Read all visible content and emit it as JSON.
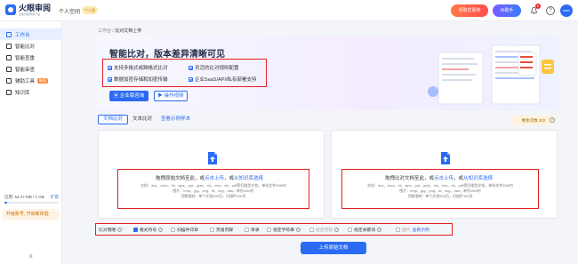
{
  "header": {
    "logo_title": "火眼审阅",
    "logo_sub": "全能智能审阅产品",
    "space_name": "个人空间",
    "plan_badge": "个人版",
    "promo_button": "领取优惠券",
    "ai_button": "AI助手",
    "notification_count": "6",
    "avatar_text": "user"
  },
  "sidebar": {
    "items": [
      {
        "label": "工作台"
      },
      {
        "label": "智能比对"
      },
      {
        "label": "智能查重"
      },
      {
        "label": "智能审查"
      },
      {
        "label": "辅助工具",
        "tag": "新版"
      },
      {
        "label": "知识库"
      }
    ],
    "storage_text": "已用: 54.47 MB / 1 GB",
    "expand_label": "扩容",
    "storage_used_fraction": 0.05,
    "upgrade_label": "升级账号, 开启新体验",
    "collapse_label": "≡"
  },
  "breadcrumb": {
    "parent": "工作台",
    "separator": " / ",
    "current": "比对文档上传"
  },
  "banner": {
    "title": "智能比对，版本差异清晰可见",
    "features": [
      "支持多格式或跨格式比对",
      "灵活的比对规则配置",
      "数据加密存储和加密传输",
      "企业SaaS/API/私有部署支持"
    ],
    "primary_button": "企业版咨询",
    "video_button": "操作视频"
  },
  "tabs": [
    {
      "label": "文档比对",
      "active": true
    },
    {
      "label": "文本比对",
      "active": false
    },
    {
      "label": "查看示例样本",
      "active": false,
      "link": true
    }
  ],
  "quota": {
    "text": "剩余次数 202"
  },
  "upload_left": {
    "title_prefix": "拖拽原始文档至此，或",
    "upload_link": "点击上传",
    "or": "，或",
    "kb_link": "从知识库选择",
    "desc_line1": "文档：doc、docx、rtf、wps、ppt、pptx、xls、xlsx、txt、pdf等扫描型文档，单份文件50M内",
    "desc_line2": "图片：bmp、jpg、png、tif、svg、raw，单份10M内",
    "desc_line3": "页数限制：单个文档500页，扫描件100页"
  },
  "upload_right": {
    "title_prefix": "拖拽比对文档至此，或",
    "upload_link": "点击上传",
    "or": "，或",
    "kb_link": "从知识库选择",
    "desc_line1": "文档：doc、docx、rtf、wps、ppt、pptx、xls、xlsx、txt、pdf等扫描型文档，单份文件50M内",
    "desc_line2": "图片：bmp、jpg、png、tif、svg、raw，单份10M内",
    "desc_line3": "页数限制：单个文档500页，扫描件100页"
  },
  "options": [
    {
      "label": "比对策略",
      "checked": null,
      "help": true
    },
    {
      "label": "格式符号",
      "checked": true,
      "help": true
    },
    {
      "label": "扫描件印章",
      "checked": false,
      "help": false
    },
    {
      "label": "页眉页脚",
      "checked": false,
      "help": false
    },
    {
      "label": "目录",
      "checked": false,
      "help": false
    },
    {
      "label": "指定字符串",
      "checked": false,
      "help": true
    },
    {
      "label": "指定页码",
      "checked": false,
      "help": true,
      "dim": true
    },
    {
      "label": "指定关键词",
      "checked": false,
      "help": true
    },
    {
      "label": "图片",
      "checked": false,
      "help": false,
      "dim": true
    }
  ],
  "options_link": "查看示例",
  "submit_button": "上传原始文档"
}
